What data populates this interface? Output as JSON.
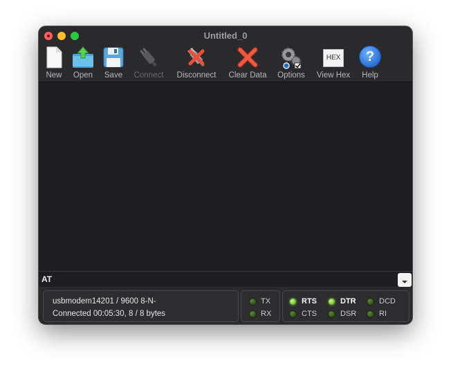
{
  "window": {
    "title": "Untitled_0"
  },
  "toolbar": {
    "new": "New",
    "open": "Open",
    "save": "Save",
    "connect": "Connect",
    "disconnect": "Disconnect",
    "clear": "Clear Data",
    "options": "Options",
    "viewhex": "View Hex",
    "help": "Help",
    "hex_icon_text": "HEX",
    "help_icon_text": "?"
  },
  "command": {
    "value": "AT"
  },
  "status": {
    "port_line": "usbmodem14201 / 9600 8-N-",
    "connected_line": "Connected 00:05:30, 8 / 8 bytes",
    "signals": {
      "tx": "TX",
      "rx": "RX",
      "rts": "RTS",
      "cts": "CTS",
      "dtr": "DTR",
      "dsr": "DSR",
      "dcd": "DCD",
      "ri": "RI"
    }
  },
  "colors": {
    "led_on": "#7ac52a",
    "led_off": "#2f4f18",
    "output_bg": "#1f1d24"
  }
}
